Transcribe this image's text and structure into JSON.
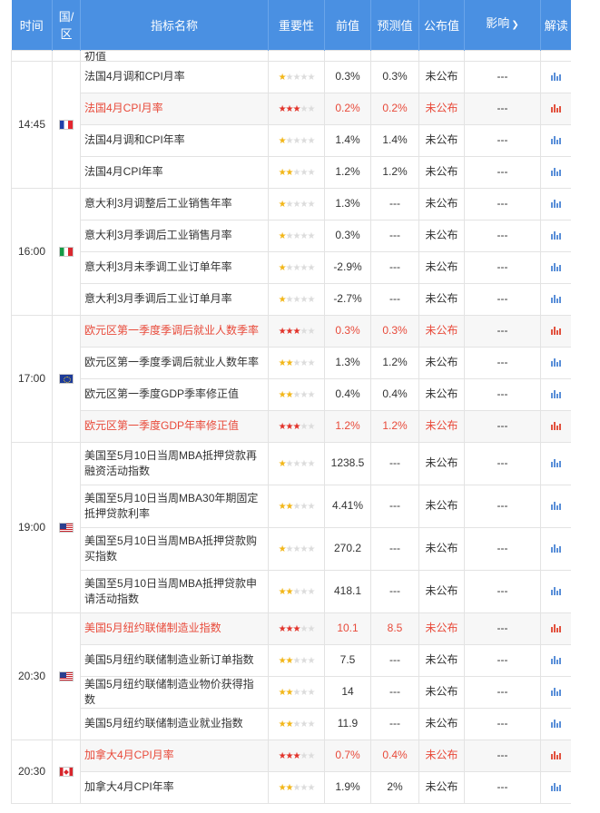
{
  "headers": {
    "time": "时间",
    "region": "国/区",
    "indicator": "指标名称",
    "importance": "重要性",
    "previous": "前值",
    "forecast": "预测值",
    "actual": "公布值",
    "impact": "影响",
    "interpret": "解读"
  },
  "partial_row": {
    "name": "初值"
  },
  "groups": [
    {
      "time": "14:45",
      "flag": "flag-fr",
      "rows": [
        {
          "name": "法国4月调和CPI月率",
          "stars": 1,
          "previous": "0.3%",
          "forecast": "0.3%",
          "actual": "未公布",
          "impact": "---",
          "hl": false
        },
        {
          "name": "法国4月CPI月率",
          "stars": 3,
          "previous": "0.2%",
          "forecast": "0.2%",
          "actual": "未公布",
          "impact": "---",
          "hl": true
        },
        {
          "name": "法国4月调和CPI年率",
          "stars": 1,
          "previous": "1.4%",
          "forecast": "1.4%",
          "actual": "未公布",
          "impact": "---",
          "hl": false
        },
        {
          "name": "法国4月CPI年率",
          "stars": 2,
          "previous": "1.2%",
          "forecast": "1.2%",
          "actual": "未公布",
          "impact": "---",
          "hl": false
        }
      ]
    },
    {
      "time": "16:00",
      "flag": "flag-it",
      "rows": [
        {
          "name": "意大利3月调整后工业销售年率",
          "stars": 1,
          "previous": "1.3%",
          "forecast": "---",
          "actual": "未公布",
          "impact": "---",
          "hl": false
        },
        {
          "name": "意大利3月季调后工业销售月率",
          "stars": 1,
          "previous": "0.3%",
          "forecast": "---",
          "actual": "未公布",
          "impact": "---",
          "hl": false
        },
        {
          "name": "意大利3月未季调工业订单年率",
          "stars": 1,
          "previous": "-2.9%",
          "forecast": "---",
          "actual": "未公布",
          "impact": "---",
          "hl": false
        },
        {
          "name": "意大利3月季调后工业订单月率",
          "stars": 1,
          "previous": "-2.7%",
          "forecast": "---",
          "actual": "未公布",
          "impact": "---",
          "hl": false
        }
      ]
    },
    {
      "time": "17:00",
      "flag": "flag-eu",
      "rows": [
        {
          "name": "欧元区第一季度季调后就业人数季率",
          "stars": 3,
          "previous": "0.3%",
          "forecast": "0.3%",
          "actual": "未公布",
          "impact": "---",
          "hl": true
        },
        {
          "name": "欧元区第一季度季调后就业人数年率",
          "stars": 2,
          "previous": "1.3%",
          "forecast": "1.2%",
          "actual": "未公布",
          "impact": "---",
          "hl": false
        },
        {
          "name": "欧元区第一季度GDP季率修正值",
          "stars": 2,
          "previous": "0.4%",
          "forecast": "0.4%",
          "actual": "未公布",
          "impact": "---",
          "hl": false
        },
        {
          "name": "欧元区第一季度GDP年率修正值",
          "stars": 3,
          "previous": "1.2%",
          "forecast": "1.2%",
          "actual": "未公布",
          "impact": "---",
          "hl": true
        }
      ]
    },
    {
      "time": "19:00",
      "flag": "flag-us",
      "rows": [
        {
          "name": "美国至5月10日当周MBA抵押贷款再融资活动指数",
          "stars": 1,
          "previous": "1238.5",
          "forecast": "---",
          "actual": "未公布",
          "impact": "---",
          "hl": false,
          "tall": true
        },
        {
          "name": "美国至5月10日当周MBA30年期固定抵押贷款利率",
          "stars": 2,
          "previous": "4.41%",
          "forecast": "---",
          "actual": "未公布",
          "impact": "---",
          "hl": false,
          "tall": true
        },
        {
          "name": "美国至5月10日当周MBA抵押贷款购买指数",
          "stars": 1,
          "previous": "270.2",
          "forecast": "---",
          "actual": "未公布",
          "impact": "---",
          "hl": false,
          "tall": true
        },
        {
          "name": "美国至5月10日当周MBA抵押贷款申请活动指数",
          "stars": 2,
          "previous": "418.1",
          "forecast": "---",
          "actual": "未公布",
          "impact": "---",
          "hl": false,
          "tall": true
        }
      ]
    },
    {
      "time": "20:30",
      "flag": "flag-us",
      "rows": [
        {
          "name": "美国5月纽约联储制造业指数",
          "stars": 3,
          "previous": "10.1",
          "forecast": "8.5",
          "actual": "未公布",
          "impact": "---",
          "hl": true
        },
        {
          "name": "美国5月纽约联储制造业新订单指数",
          "stars": 2,
          "previous": "7.5",
          "forecast": "---",
          "actual": "未公布",
          "impact": "---",
          "hl": false
        },
        {
          "name": "美国5月纽约联储制造业物价获得指数",
          "stars": 2,
          "previous": "14",
          "forecast": "---",
          "actual": "未公布",
          "impact": "---",
          "hl": false
        },
        {
          "name": "美国5月纽约联储制造业就业指数",
          "stars": 2,
          "previous": "11.9",
          "forecast": "---",
          "actual": "未公布",
          "impact": "---",
          "hl": false
        }
      ]
    },
    {
      "time": "20:30",
      "flag": "flag-ca",
      "rows": [
        {
          "name": "加拿大4月CPI月率",
          "stars": 3,
          "previous": "0.7%",
          "forecast": "0.4%",
          "actual": "未公布",
          "impact": "---",
          "hl": true
        },
        {
          "name": "加拿大4月CPI年率",
          "stars": 2,
          "previous": "1.9%",
          "forecast": "2%",
          "actual": "未公布",
          "impact": "---",
          "hl": false
        }
      ]
    }
  ]
}
